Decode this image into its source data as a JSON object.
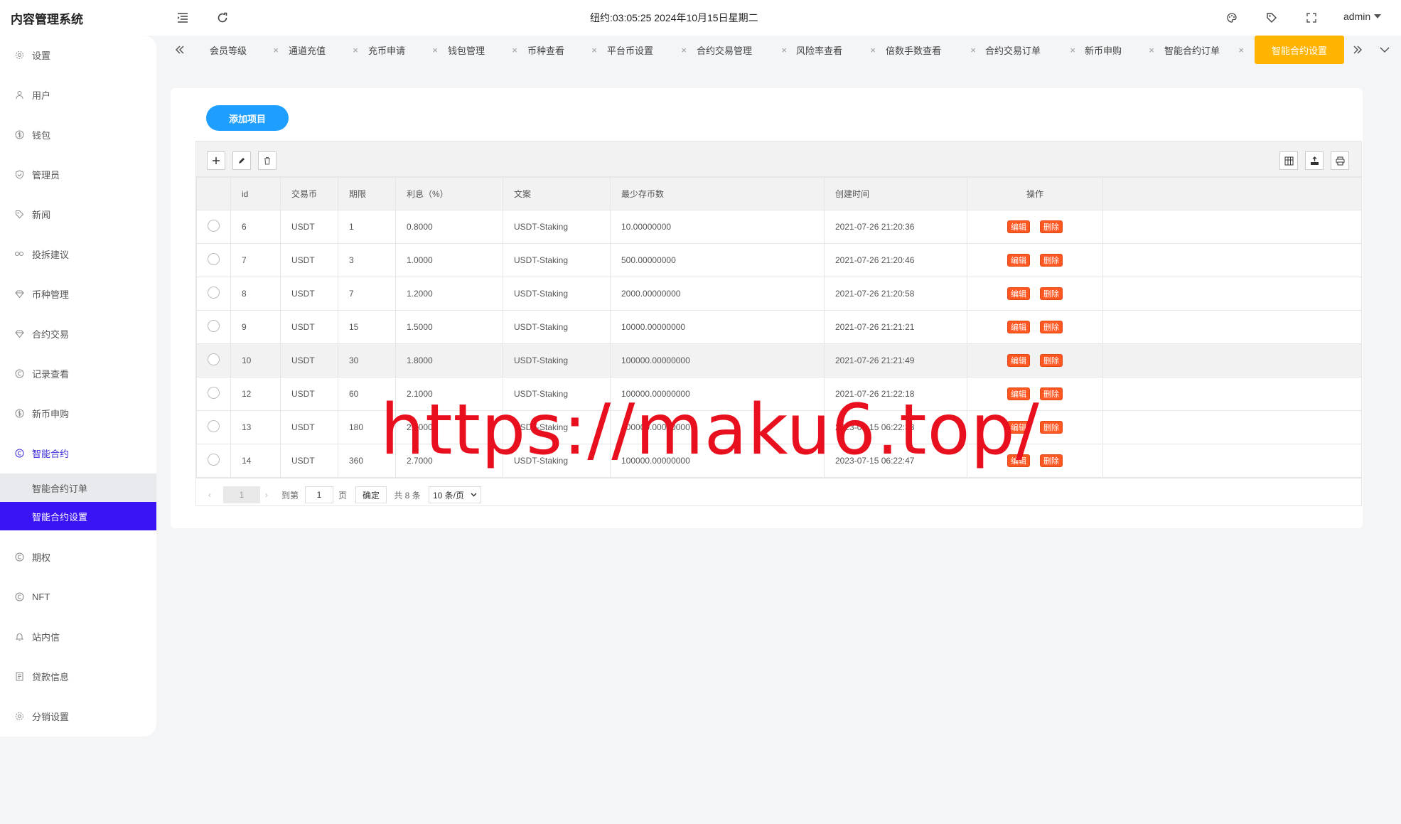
{
  "header": {
    "app_title": "内容管理系统",
    "clock": "纽约:03:05:25 2024年10月15日星期二",
    "user": "admin"
  },
  "sidebar": {
    "items": [
      {
        "label": "设置",
        "icon": "gear-icon"
      },
      {
        "label": "用户",
        "icon": "user-icon"
      },
      {
        "label": "钱包",
        "icon": "dollar-icon"
      },
      {
        "label": "管理员",
        "icon": "shield-icon"
      },
      {
        "label": "新闻",
        "icon": "tag-icon"
      },
      {
        "label": "投拆建议",
        "icon": "link-icon"
      },
      {
        "label": "币种管理",
        "icon": "diamond-icon"
      },
      {
        "label": "合约交易",
        "icon": "diamond-icon"
      },
      {
        "label": "记录查看",
        "icon": "circle-c-icon"
      },
      {
        "label": "新币申购",
        "icon": "dollar-icon"
      },
      {
        "label": "智能合约",
        "icon": "circle-c-icon"
      }
    ],
    "sub_items": [
      {
        "label": "智能合约订单"
      },
      {
        "label": "智能合约设置"
      }
    ],
    "items_after": [
      {
        "label": "期权",
        "icon": "circle-c-icon"
      },
      {
        "label": "NFT",
        "icon": "circle-c-icon"
      },
      {
        "label": "站内信",
        "icon": "bell-icon"
      },
      {
        "label": "贷款信息",
        "icon": "document-icon"
      },
      {
        "label": "分销设置",
        "icon": "gear-icon"
      }
    ]
  },
  "tabs": [
    {
      "label": "会员等级"
    },
    {
      "label": "通道充值"
    },
    {
      "label": "充币申请"
    },
    {
      "label": "钱包管理"
    },
    {
      "label": "币种查看"
    },
    {
      "label": "平台币设置"
    },
    {
      "label": "合约交易管理"
    },
    {
      "label": "风险率查看"
    },
    {
      "label": "倍数手数查看"
    },
    {
      "label": "合约交易订单"
    },
    {
      "label": "新币申购"
    },
    {
      "label": "智能合约订单"
    },
    {
      "label": "智能合约设置"
    }
  ],
  "content": {
    "add_button": "添加项目",
    "columns": [
      "id",
      "交易币",
      "期限",
      "利息（%）",
      "文案",
      "最少存币数",
      "创建时间",
      "操作"
    ],
    "edit_label": "编辑",
    "delete_label": "删除",
    "rows": [
      {
        "id": "6",
        "coin": "USDT",
        "term": "1",
        "interest": "0.8000",
        "copy": "USDT-Staking",
        "min": "10.00000000",
        "created": "2021-07-26 21:20:36"
      },
      {
        "id": "7",
        "coin": "USDT",
        "term": "3",
        "interest": "1.0000",
        "copy": "USDT-Staking",
        "min": "500.00000000",
        "created": "2021-07-26 21:20:46"
      },
      {
        "id": "8",
        "coin": "USDT",
        "term": "7",
        "interest": "1.2000",
        "copy": "USDT-Staking",
        "min": "2000.00000000",
        "created": "2021-07-26 21:20:58"
      },
      {
        "id": "9",
        "coin": "USDT",
        "term": "15",
        "interest": "1.5000",
        "copy": "USDT-Staking",
        "min": "10000.00000000",
        "created": "2021-07-26 21:21:21"
      },
      {
        "id": "10",
        "coin": "USDT",
        "term": "30",
        "interest": "1.8000",
        "copy": "USDT-Staking",
        "min": "100000.00000000",
        "created": "2021-07-26 21:21:49"
      },
      {
        "id": "12",
        "coin": "USDT",
        "term": "60",
        "interest": "2.1000",
        "copy": "USDT-Staking",
        "min": "100000.00000000",
        "created": "2021-07-26 21:22:18"
      },
      {
        "id": "13",
        "coin": "USDT",
        "term": "180",
        "interest": "2.4000",
        "copy": "USDT-Staking",
        "min": "100000.00000000",
        "created": "2023-07-15 06:22:33"
      },
      {
        "id": "14",
        "coin": "USDT",
        "term": "360",
        "interest": "2.7000",
        "copy": "USDT-Staking",
        "min": "100000.00000000",
        "created": "2023-07-15 06:22:47"
      }
    ]
  },
  "pager": {
    "current_page": "1",
    "goto_label": "到第",
    "goto_value": "1",
    "page_unit": "页",
    "confirm": "确定",
    "total": "共 8 条",
    "per_page": "10 条/页"
  },
  "watermark": "https://maku6.top/",
  "colors": {
    "accent_blue": "#1e9fff",
    "active_purple": "#3a14f5",
    "active_tab": "#ffb400",
    "danger": "#ff5722",
    "watermark": "#e8101e"
  }
}
